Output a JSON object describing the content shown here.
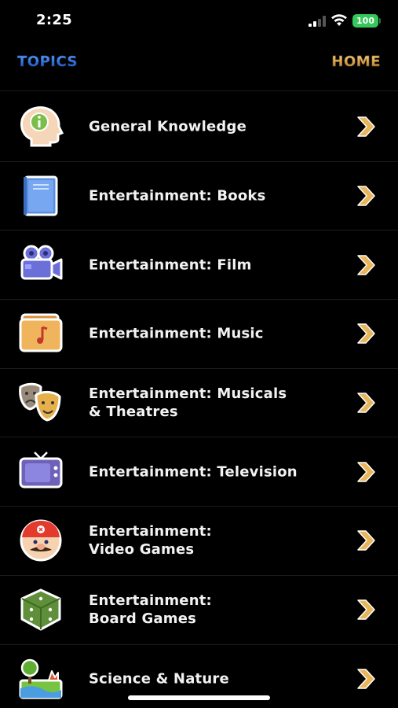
{
  "status_bar": {
    "time": "2:25",
    "battery_level": "100",
    "battery_color": "#35c759"
  },
  "nav": {
    "left_label": "TOPICS",
    "right_label": "HOME"
  },
  "topics": [
    {
      "label": "General Knowledge",
      "icon": "head-info-icon"
    },
    {
      "label": "Entertainment: Books",
      "icon": "book-icon"
    },
    {
      "label": "Entertainment: Film",
      "icon": "film-camera-icon"
    },
    {
      "label": "Entertainment: Music",
      "icon": "music-folder-icon"
    },
    {
      "label": "Entertainment: Musicals\n& Theatres",
      "icon": "theatre-masks-icon"
    },
    {
      "label": "Entertainment: Television",
      "icon": "television-icon"
    },
    {
      "label": "Entertainment:\nVideo Games",
      "icon": "mario-icon"
    },
    {
      "label": "Entertainment:\nBoard Games",
      "icon": "dice-icon"
    },
    {
      "label": "Science & Nature",
      "icon": "nature-icon"
    }
  ],
  "colors": {
    "background": "#000000",
    "topics_accent": "#2e6fd8",
    "home_accent": "#d9a24a",
    "chevron": "#e8b55a"
  }
}
